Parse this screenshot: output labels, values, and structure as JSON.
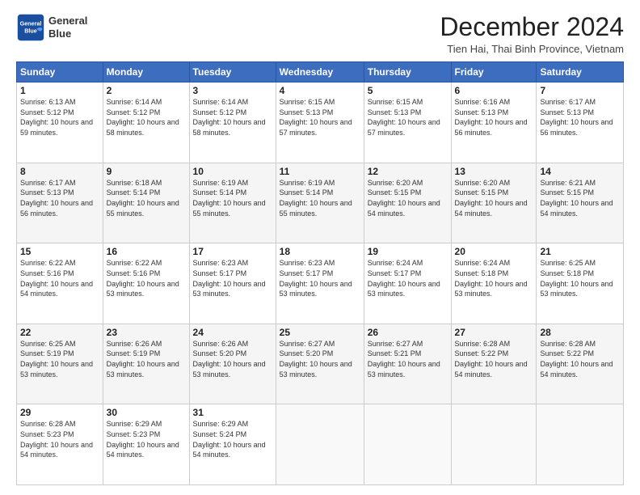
{
  "header": {
    "logo_line1": "General",
    "logo_line2": "Blue",
    "title": "December 2024",
    "subtitle": "Tien Hai, Thai Binh Province, Vietnam"
  },
  "weekdays": [
    "Sunday",
    "Monday",
    "Tuesday",
    "Wednesday",
    "Thursday",
    "Friday",
    "Saturday"
  ],
  "weeks": [
    [
      {
        "day": "1",
        "sunrise": "6:13 AM",
        "sunset": "5:12 PM",
        "daylight": "10 hours and 59 minutes."
      },
      {
        "day": "2",
        "sunrise": "6:14 AM",
        "sunset": "5:12 PM",
        "daylight": "10 hours and 58 minutes."
      },
      {
        "day": "3",
        "sunrise": "6:14 AM",
        "sunset": "5:12 PM",
        "daylight": "10 hours and 58 minutes."
      },
      {
        "day": "4",
        "sunrise": "6:15 AM",
        "sunset": "5:13 PM",
        "daylight": "10 hours and 57 minutes."
      },
      {
        "day": "5",
        "sunrise": "6:15 AM",
        "sunset": "5:13 PM",
        "daylight": "10 hours and 57 minutes."
      },
      {
        "day": "6",
        "sunrise": "6:16 AM",
        "sunset": "5:13 PM",
        "daylight": "10 hours and 56 minutes."
      },
      {
        "day": "7",
        "sunrise": "6:17 AM",
        "sunset": "5:13 PM",
        "daylight": "10 hours and 56 minutes."
      }
    ],
    [
      {
        "day": "8",
        "sunrise": "6:17 AM",
        "sunset": "5:13 PM",
        "daylight": "10 hours and 56 minutes."
      },
      {
        "day": "9",
        "sunrise": "6:18 AM",
        "sunset": "5:14 PM",
        "daylight": "10 hours and 55 minutes."
      },
      {
        "day": "10",
        "sunrise": "6:19 AM",
        "sunset": "5:14 PM",
        "daylight": "10 hours and 55 minutes."
      },
      {
        "day": "11",
        "sunrise": "6:19 AM",
        "sunset": "5:14 PM",
        "daylight": "10 hours and 55 minutes."
      },
      {
        "day": "12",
        "sunrise": "6:20 AM",
        "sunset": "5:15 PM",
        "daylight": "10 hours and 54 minutes."
      },
      {
        "day": "13",
        "sunrise": "6:20 AM",
        "sunset": "5:15 PM",
        "daylight": "10 hours and 54 minutes."
      },
      {
        "day": "14",
        "sunrise": "6:21 AM",
        "sunset": "5:15 PM",
        "daylight": "10 hours and 54 minutes."
      }
    ],
    [
      {
        "day": "15",
        "sunrise": "6:22 AM",
        "sunset": "5:16 PM",
        "daylight": "10 hours and 54 minutes."
      },
      {
        "day": "16",
        "sunrise": "6:22 AM",
        "sunset": "5:16 PM",
        "daylight": "10 hours and 53 minutes."
      },
      {
        "day": "17",
        "sunrise": "6:23 AM",
        "sunset": "5:17 PM",
        "daylight": "10 hours and 53 minutes."
      },
      {
        "day": "18",
        "sunrise": "6:23 AM",
        "sunset": "5:17 PM",
        "daylight": "10 hours and 53 minutes."
      },
      {
        "day": "19",
        "sunrise": "6:24 AM",
        "sunset": "5:17 PM",
        "daylight": "10 hours and 53 minutes."
      },
      {
        "day": "20",
        "sunrise": "6:24 AM",
        "sunset": "5:18 PM",
        "daylight": "10 hours and 53 minutes."
      },
      {
        "day": "21",
        "sunrise": "6:25 AM",
        "sunset": "5:18 PM",
        "daylight": "10 hours and 53 minutes."
      }
    ],
    [
      {
        "day": "22",
        "sunrise": "6:25 AM",
        "sunset": "5:19 PM",
        "daylight": "10 hours and 53 minutes."
      },
      {
        "day": "23",
        "sunrise": "6:26 AM",
        "sunset": "5:19 PM",
        "daylight": "10 hours and 53 minutes."
      },
      {
        "day": "24",
        "sunrise": "6:26 AM",
        "sunset": "5:20 PM",
        "daylight": "10 hours and 53 minutes."
      },
      {
        "day": "25",
        "sunrise": "6:27 AM",
        "sunset": "5:20 PM",
        "daylight": "10 hours and 53 minutes."
      },
      {
        "day": "26",
        "sunrise": "6:27 AM",
        "sunset": "5:21 PM",
        "daylight": "10 hours and 53 minutes."
      },
      {
        "day": "27",
        "sunrise": "6:28 AM",
        "sunset": "5:22 PM",
        "daylight": "10 hours and 54 minutes."
      },
      {
        "day": "28",
        "sunrise": "6:28 AM",
        "sunset": "5:22 PM",
        "daylight": "10 hours and 54 minutes."
      }
    ],
    [
      {
        "day": "29",
        "sunrise": "6:28 AM",
        "sunset": "5:23 PM",
        "daylight": "10 hours and 54 minutes."
      },
      {
        "day": "30",
        "sunrise": "6:29 AM",
        "sunset": "5:23 PM",
        "daylight": "10 hours and 54 minutes."
      },
      {
        "day": "31",
        "sunrise": "6:29 AM",
        "sunset": "5:24 PM",
        "daylight": "10 hours and 54 minutes."
      },
      null,
      null,
      null,
      null
    ]
  ]
}
